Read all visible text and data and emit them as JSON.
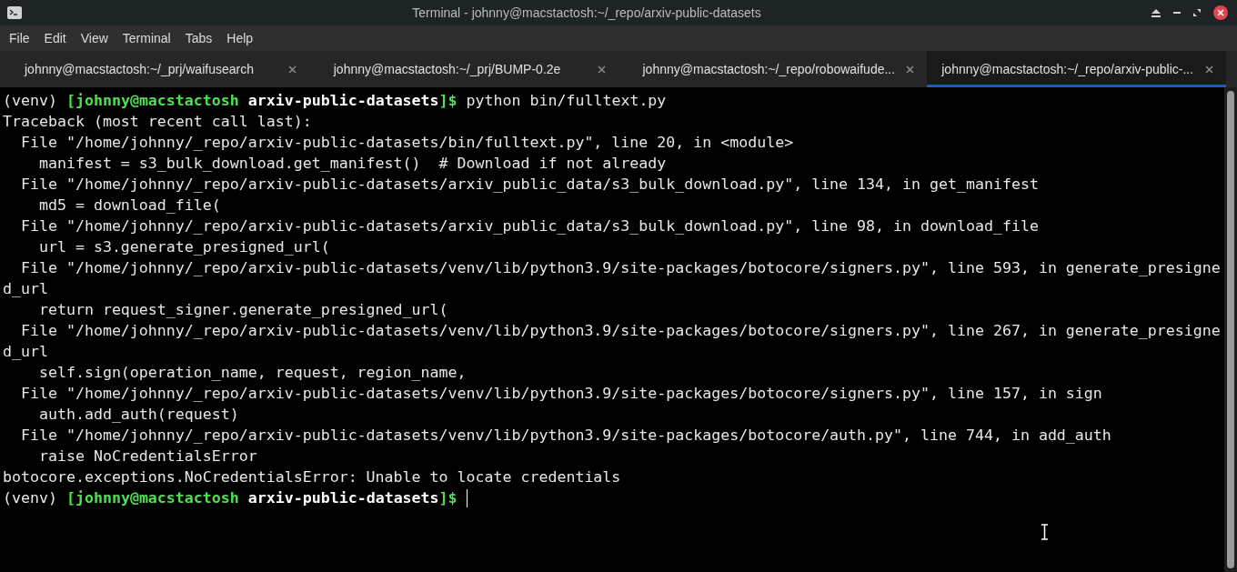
{
  "window": {
    "title": "Terminal - johnny@macstactosh:~/_repo/arxiv-public-datasets"
  },
  "menu": [
    "File",
    "Edit",
    "View",
    "Terminal",
    "Tabs",
    "Help"
  ],
  "tabs": [
    {
      "label": "johnny@macstactosh:~/_prj/waifusearch",
      "selected": false
    },
    {
      "label": "johnny@macstactosh:~/_prj/BUMP-0.2e",
      "selected": false
    },
    {
      "label": "johnny@macstactosh:~/_repo/robowaifude...",
      "selected": false
    },
    {
      "label": "johnny@macstactosh:~/_repo/arxiv-public-...",
      "selected": true
    }
  ],
  "terminal": {
    "lines": [
      {
        "kind": "prompt",
        "env": "(venv)",
        "user": "[johnny@macstactosh",
        "dir": "arxiv-public-datasets",
        "end": "]$",
        "command": "python bin/fulltext.py"
      },
      {
        "kind": "output",
        "text": "Traceback (most recent call last):"
      },
      {
        "kind": "output",
        "text": "  File \"/home/johnny/_repo/arxiv-public-datasets/bin/fulltext.py\", line 20, in <module>"
      },
      {
        "kind": "output",
        "text": "    manifest = s3_bulk_download.get_manifest()  # Download if not already"
      },
      {
        "kind": "output",
        "text": "  File \"/home/johnny/_repo/arxiv-public-datasets/arxiv_public_data/s3_bulk_download.py\", line 134, in get_manifest"
      },
      {
        "kind": "output",
        "text": "    md5 = download_file("
      },
      {
        "kind": "output",
        "text": "  File \"/home/johnny/_repo/arxiv-public-datasets/arxiv_public_data/s3_bulk_download.py\", line 98, in download_file"
      },
      {
        "kind": "output",
        "text": "    url = s3.generate_presigned_url("
      },
      {
        "kind": "output",
        "text": "  File \"/home/johnny/_repo/arxiv-public-datasets/venv/lib/python3.9/site-packages/botocore/signers.py\", line 593, in generate_presigne"
      },
      {
        "kind": "output",
        "text": "d_url"
      },
      {
        "kind": "output",
        "text": "    return request_signer.generate_presigned_url("
      },
      {
        "kind": "output",
        "text": "  File \"/home/johnny/_repo/arxiv-public-datasets/venv/lib/python3.9/site-packages/botocore/signers.py\", line 267, in generate_presigne"
      },
      {
        "kind": "output",
        "text": "d_url"
      },
      {
        "kind": "output",
        "text": "    self.sign(operation_name, request, region_name,"
      },
      {
        "kind": "output",
        "text": "  File \"/home/johnny/_repo/arxiv-public-datasets/venv/lib/python3.9/site-packages/botocore/signers.py\", line 157, in sign"
      },
      {
        "kind": "output",
        "text": "    auth.add_auth(request)"
      },
      {
        "kind": "output",
        "text": "  File \"/home/johnny/_repo/arxiv-public-datasets/venv/lib/python3.9/site-packages/botocore/auth.py\", line 744, in add_auth"
      },
      {
        "kind": "output",
        "text": "    raise NoCredentialsError"
      },
      {
        "kind": "output",
        "text": "botocore.exceptions.NoCredentialsError: Unable to locate credentials"
      },
      {
        "kind": "prompt",
        "env": "(venv)",
        "user": "[johnny@macstactosh",
        "dir": "arxiv-public-datasets",
        "end": "]$",
        "cursor": true
      }
    ]
  }
}
